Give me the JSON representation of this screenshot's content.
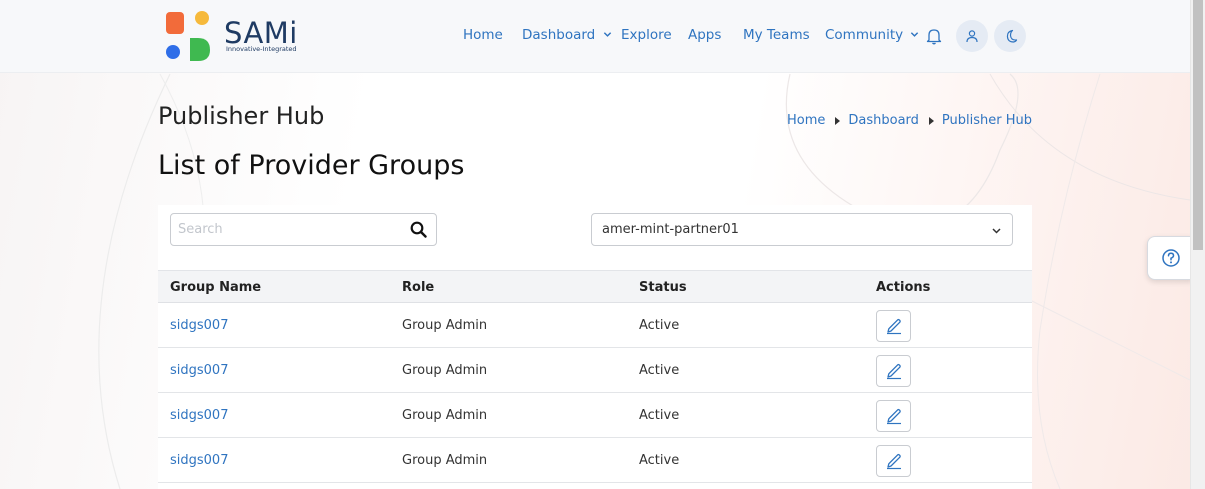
{
  "brand": {
    "name": "SAMi",
    "tagline": "Innovative-Integrated",
    "colors": {
      "orange": "#f26b3a",
      "yellow": "#f6b93b",
      "blue": "#2f6ee8",
      "green": "#3fb950",
      "navy": "#1f3b63"
    }
  },
  "nav": {
    "items": [
      {
        "label": "Home"
      },
      {
        "label": "Dashboard",
        "dropdown": true
      },
      {
        "label": "Explore"
      },
      {
        "label": "Apps"
      },
      {
        "label": "My Teams"
      },
      {
        "label": "Community",
        "dropdown": true
      }
    ],
    "icons": [
      "bell-icon",
      "user-icon",
      "moon-icon"
    ]
  },
  "header": {
    "title": "Publisher Hub",
    "breadcrumb": [
      "Home",
      "Dashboard",
      "Publisher Hub"
    ]
  },
  "main": {
    "heading": "List of Provider Groups",
    "search": {
      "placeholder": "Search",
      "value": ""
    },
    "select": {
      "value": "amer-mint-partner01"
    },
    "table": {
      "columns": [
        "Group Name",
        "Role",
        "Status",
        "Actions"
      ],
      "rows": [
        {
          "name": "sidgs007",
          "role": "Group Admin",
          "status": "Active"
        },
        {
          "name": "sidgs007",
          "role": "Group Admin",
          "status": "Active"
        },
        {
          "name": "sidgs007",
          "role": "Group Admin",
          "status": "Active"
        },
        {
          "name": "sidgs007",
          "role": "Group Admin",
          "status": "Active"
        }
      ]
    }
  },
  "colors": {
    "link": "#2f74c0",
    "accent_circle": "#e5ebf4"
  }
}
